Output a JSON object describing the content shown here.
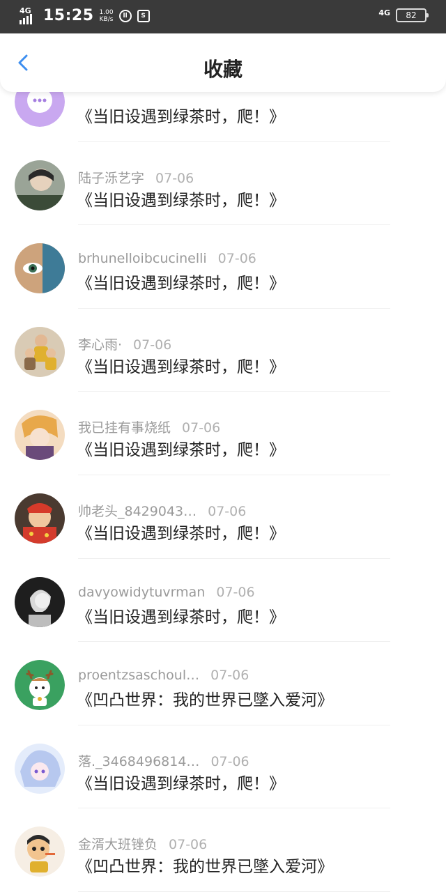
{
  "status": {
    "network": "4G",
    "time": "15:25",
    "speed_value": "1.00",
    "speed_unit": "KB/s",
    "network_right": "4G",
    "battery": "82"
  },
  "header": {
    "title": "收藏"
  },
  "items": [
    {
      "name": "",
      "date": "",
      "title": "《当旧设遇到绿茶时，爬！》",
      "avatar_color": "#c9a8f0"
    },
    {
      "name": "陆子泺艺字",
      "date": "07-06",
      "title": "《当旧设遇到绿茶时，爬！》",
      "avatar_color": "#7d8a7a"
    },
    {
      "name": "brhunelloibcucinelli",
      "date": "07-06",
      "title": "《当旧设遇到绿茶时，爬！》",
      "avatar_color": "#3f6f86"
    },
    {
      "name": "李心雨·",
      "date": "07-06",
      "title": "《当旧设遇到绿茶时，爬！》",
      "avatar_color": "#c9a05a"
    },
    {
      "name": "我已挂有事烧纸",
      "date": "07-06",
      "title": "《当旧设遇到绿茶时，爬！》",
      "avatar_color": "#e8b98a"
    },
    {
      "name": "帅老头_8429043…",
      "date": "07-06",
      "title": "《当旧设遇到绿茶时，爬！》",
      "avatar_color": "#c0392b"
    },
    {
      "name": "davyowidytuvrman",
      "date": "07-06",
      "title": "《当旧设遇到绿茶时，爬！》",
      "avatar_color": "#2b2b2b"
    },
    {
      "name": "proentzsaschoul…",
      "date": "07-06",
      "title": "《凹凸世界：我的世界已墜入爱河》",
      "avatar_color": "#3aa160"
    },
    {
      "name": "落._3468496814…",
      "date": "07-06",
      "title": "《当旧设遇到绿茶时，爬！》",
      "avatar_color": "#b7c8ef"
    },
    {
      "name": "金湑大班锉负",
      "date": "07-06",
      "title": "《凹凸世界：我的世界已墜入爱河》",
      "avatar_color": "#f2d7b0"
    }
  ]
}
